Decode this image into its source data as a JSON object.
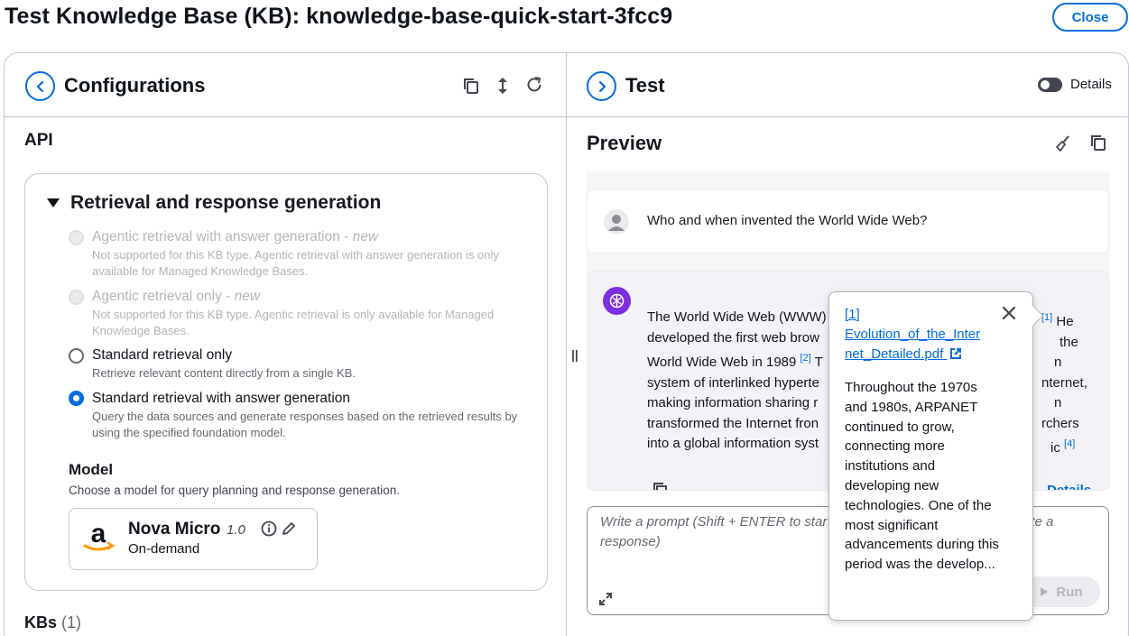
{
  "header": {
    "title": "Test Knowledge Base (KB): knowledge-base-quick-start-3fcc9",
    "close_label": "Close"
  },
  "configurations": {
    "title": "Configurations",
    "api_label": "API",
    "retrieval": {
      "title": "Retrieval and response generation",
      "options": [
        {
          "label": "Agentic retrieval with answer generation - ",
          "tag": "new",
          "desc": "Not supported for this KB type. Agentic retrieval with answer generation is only available for Managed Knowledge Bases.",
          "state": "disabled"
        },
        {
          "label": "Agentic retrieval only - ",
          "tag": "new",
          "desc": "Not supported for this KB type. Agentic retrieval is only available for Managed Knowledge Bases.",
          "state": "disabled"
        },
        {
          "label": "Standard retrieval only",
          "tag": "",
          "desc": "Retrieve relevant content directly from a single KB.",
          "state": "unselected"
        },
        {
          "label": "Standard retrieval with answer generation",
          "tag": "",
          "desc": "Query the data sources and generate responses based on the retrieved results by using the specified foundation model.",
          "state": "selected"
        }
      ]
    },
    "model": {
      "heading": "Model",
      "description": "Choose a model for query planning and response generation.",
      "name": "Nova Micro",
      "version": "1.0",
      "throughput": "On-demand"
    },
    "kbs": {
      "label": "KBs",
      "count": "(1)"
    }
  },
  "test": {
    "title": "Test",
    "details_toggle_label": "Details",
    "preview_title": "Preview",
    "user_question": "Who and when invented the World Wide Web?",
    "bot_lines": [
      "The World Wide Web (WWW)",
      "developed the first web brow",
      "World Wide Web in 1989",
      "system of interlinked hyperte",
      "making information sharing r",
      "transformed the Internet fron",
      "into a global information syst"
    ],
    "bot_right_lines": [
      "He",
      "the",
      "n",
      "nternet,",
      "n",
      "rchers",
      "ic"
    ],
    "citations": [
      "[1]",
      "[2]",
      "[4]"
    ],
    "bot_details_label": "Details",
    "prompt_placeholder_a": "Write a prompt (Shift + ENTER to star",
    "prompt_placeholder_b": "te a",
    "prompt_placeholder_c": "response)",
    "run_label": "Run"
  },
  "popover": {
    "ref": "[1]",
    "file": "Evolution_of_the_Internet_Detailed.pdf",
    "file_line1": "Evolution_of_the_Inter",
    "file_line2": "net_Detailed.pdf",
    "excerpt": "Throughout the 1970s and 1980s, ARPANET continued to grow, connecting more institutions and developing new technologies. One of the most significant advancements during this period was the develop..."
  },
  "colors": {
    "accent": "#006ce0",
    "border": "#c6c6cd",
    "ai_avatar": "#7d2ee0"
  }
}
